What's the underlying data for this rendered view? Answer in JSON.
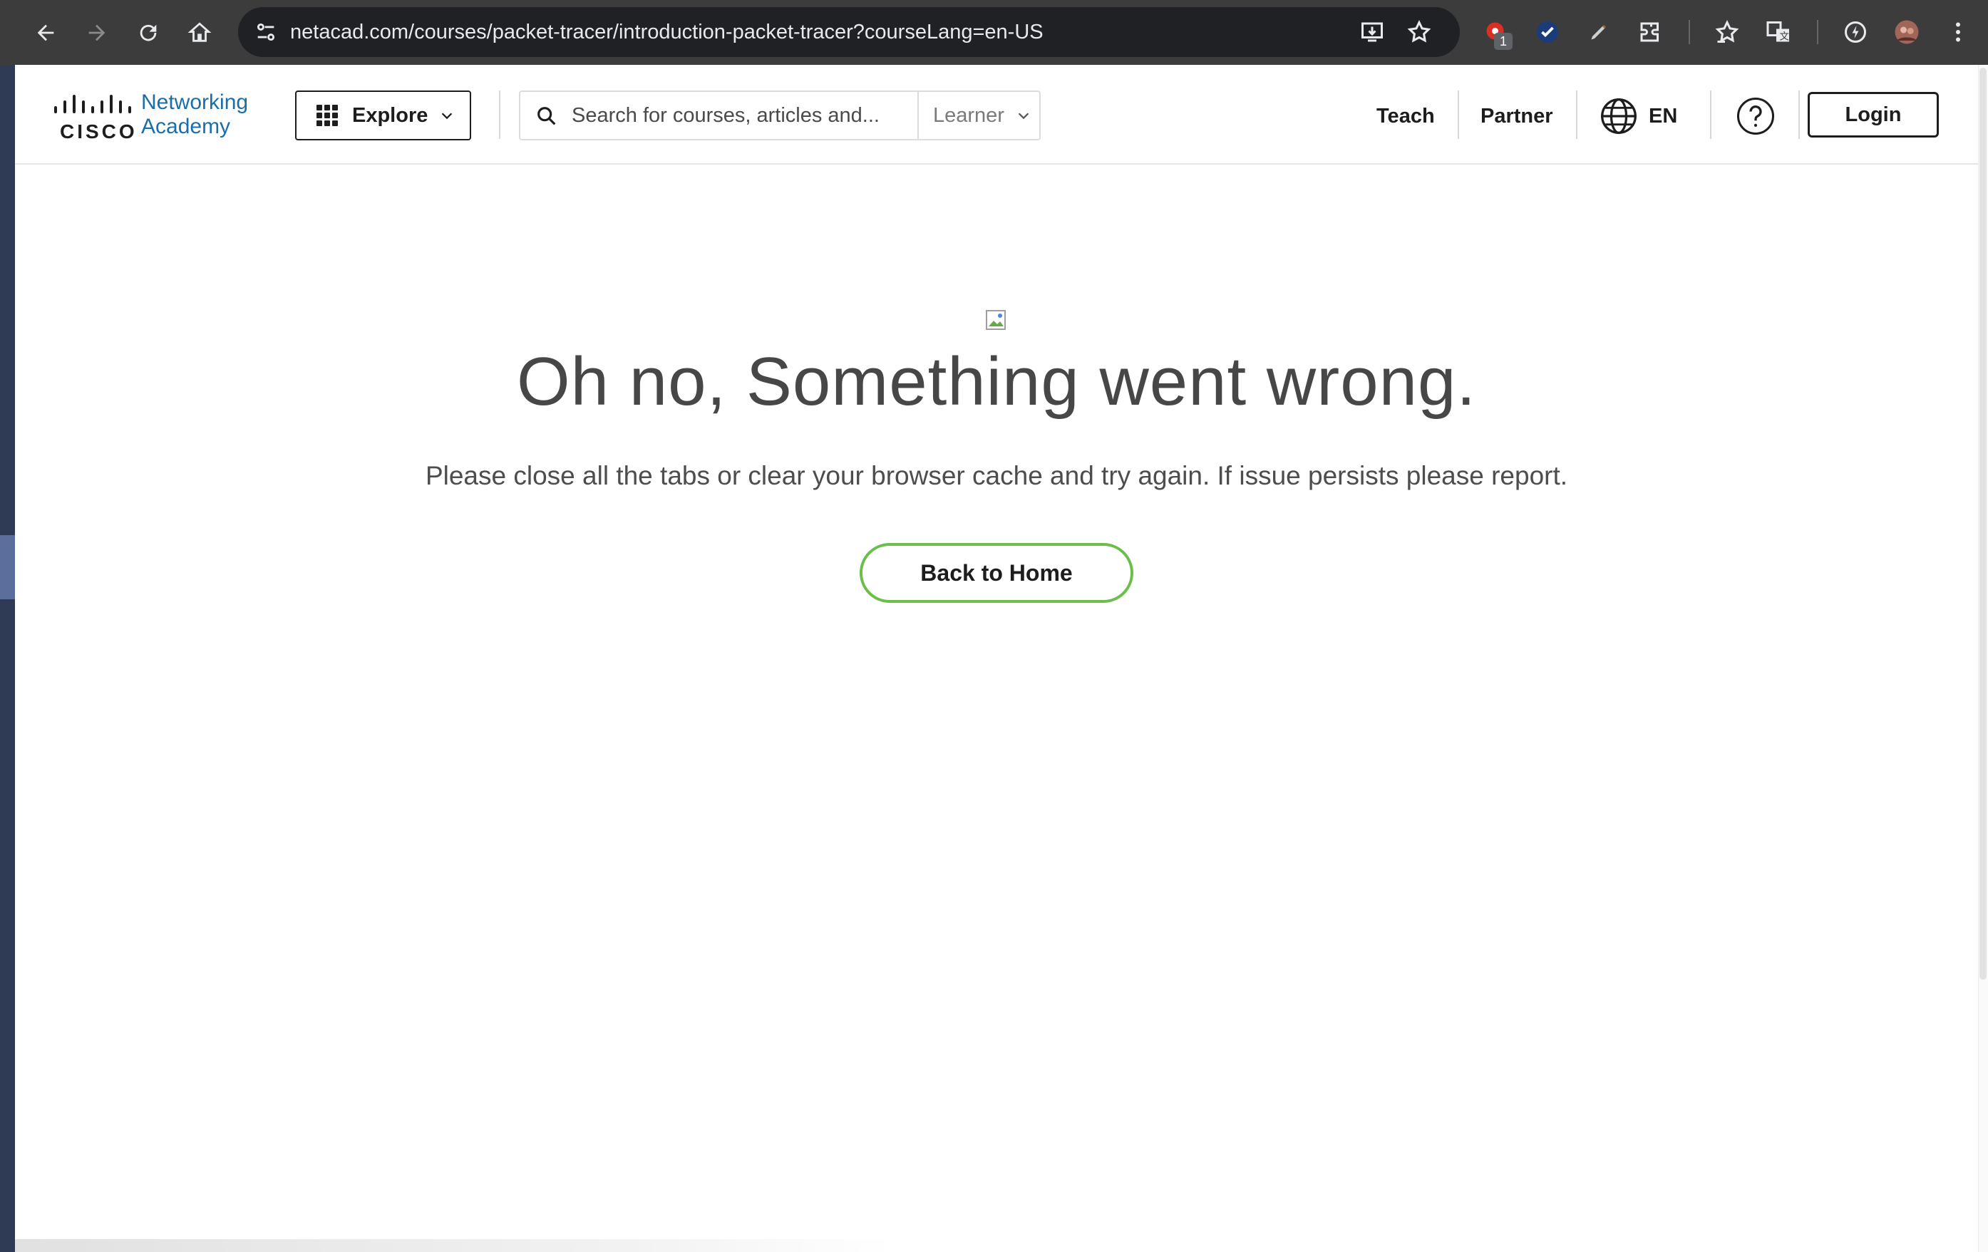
{
  "browser": {
    "url": "netacad.com/courses/packet-tracer/introduction-packet-tracer?courseLang=en-US",
    "extension_badge": "1",
    "toolbar_icons": [
      "back-arrow-icon",
      "forward-arrow-icon",
      "reload-icon",
      "home-icon",
      "site-info-icon",
      "install-app-icon",
      "bookmark-star-icon",
      "extension-red-icon",
      "extension-check-icon",
      "extension-pen-icon",
      "puzzle-icon",
      "bookmarks-icon",
      "translate-icon",
      "performance-icon",
      "profile-avatar-icon",
      "kebab-menu-icon"
    ]
  },
  "header": {
    "logo_word": "CISCO",
    "logo_line1": "Networking",
    "logo_line2": "Academy",
    "explore_label": "Explore",
    "search_placeholder": "Search for courses, articles and...",
    "role_label": "Learner",
    "teach_label": "Teach",
    "partner_label": "Partner",
    "lang_label": "EN",
    "login_label": "Login"
  },
  "error": {
    "title": "Oh no, Something went wrong.",
    "message": "Please close all the tabs or clear your browser cache and try again. If issue persists please report.",
    "button_label": "Back to Home"
  },
  "colors": {
    "brand_blue": "#1a6eab",
    "button_border_green": "#6abf4b",
    "chrome_bg": "#3c3c3c",
    "omnibox_bg": "#202124"
  }
}
